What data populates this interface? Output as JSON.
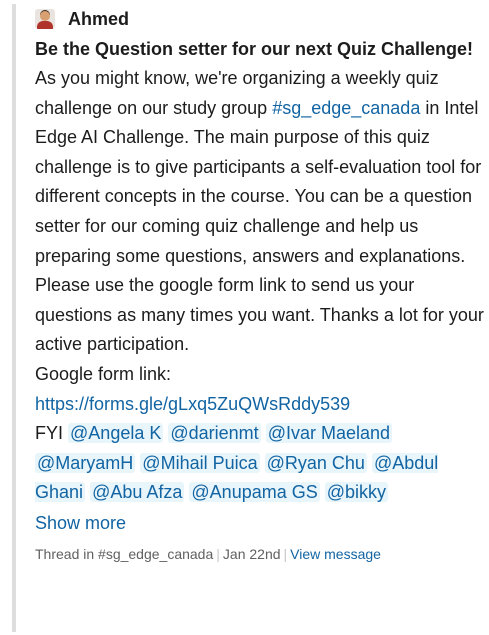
{
  "author": "Ahmed",
  "title": "Be the Question setter for our next Quiz Challenge!",
  "body": {
    "intro": "As you might know, we're organizing a weekly quiz challenge on our study group",
    "channel": "#sg_edge_canada",
    "rest": "in Intel Edge AI Challenge. The main purpose of this quiz challenge is to give participants a self-evaluation tool for different concepts in the course. You can be a question setter for our coming quiz challenge and help us preparing some questions, answers and explanations. Please use the google form link to send us your questions as many times you want. Thanks a lot for your active participation.",
    "form_label": "Google form link:",
    "form_url": "https://forms.gle/gLxq5ZuQWsRddy539",
    "fyi": "FYI"
  },
  "mentions": [
    "@Angela K",
    "@darienmt",
    "@Ivar Maeland",
    "@MaryamH",
    "@Mihail Puica",
    "@Ryan Chu",
    "@Abdul Ghani",
    "@Abu Afza",
    "@Anupama GS",
    "@bikky"
  ],
  "show_more": "Show more",
  "footer": {
    "thread": "Thread in #sg_edge_canada",
    "date": "Jan 22nd",
    "view": "View message"
  }
}
